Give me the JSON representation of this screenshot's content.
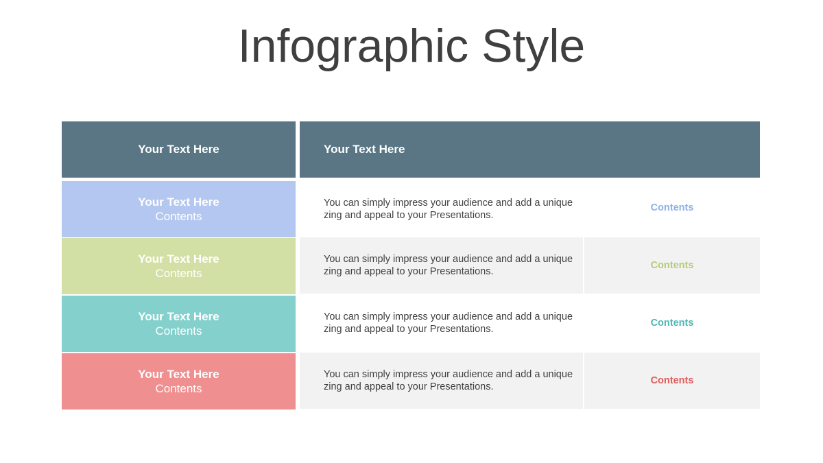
{
  "title": "Infographic Style",
  "header": {
    "left": "Your Text  Here",
    "right": "Your Text  Here"
  },
  "rows": [
    {
      "label": "Your Text  Here",
      "sub": "Contents",
      "description": "You can simply impress your audience and add a unique zing and appeal to your Presentations.",
      "contents": "Contents",
      "color": "#b4c7f0",
      "accent": "#8fb0e8"
    },
    {
      "label": "Your Text  Here",
      "sub": "Contents",
      "description": "You can simply impress your audience and add a unique zing and appeal to your Presentations.",
      "contents": "Contents",
      "color": "#d2e0a6",
      "accent": "#b5cc78"
    },
    {
      "label": "Your Text  Here",
      "sub": "Contents",
      "description": "You can simply impress your audience and add a unique zing and appeal to your Presentations.",
      "contents": "Contents",
      "color": "#84d0cc",
      "accent": "#4fb5b5"
    },
    {
      "label": "Your Text  Here",
      "sub": "Contents",
      "description": "You can simply impress your audience and add a unique zing and appeal to your Presentations.",
      "contents": "Contents",
      "color": "#ef8f8f",
      "accent": "#e05c5c"
    }
  ],
  "colors": {
    "header": "#5a7685",
    "shaded_row": "#f2f2f2"
  }
}
